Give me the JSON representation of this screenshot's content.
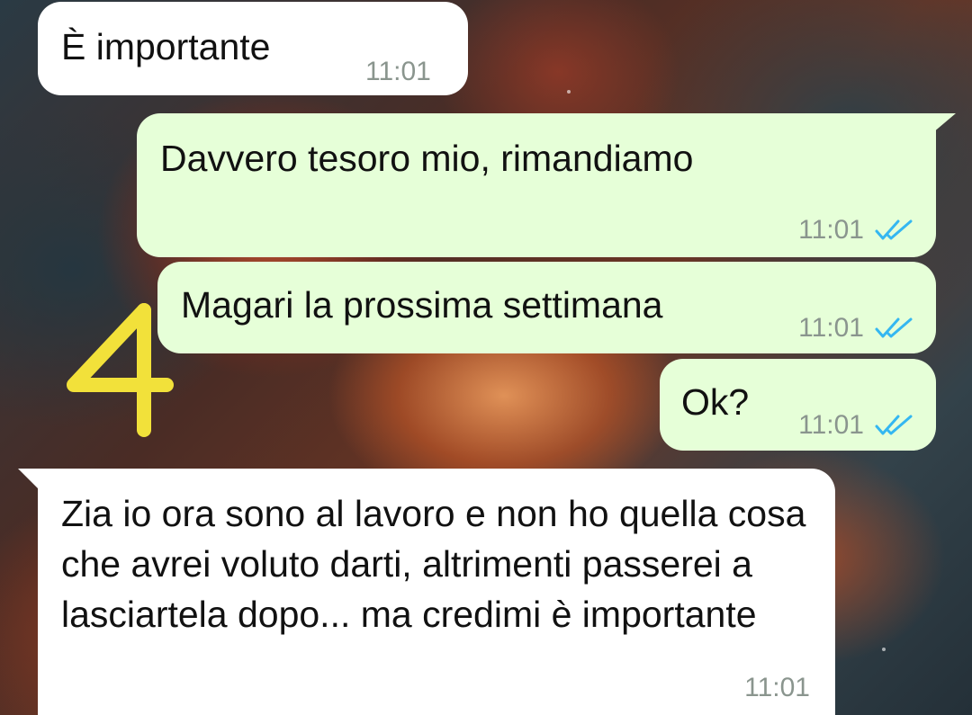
{
  "chat": {
    "messages": [
      {
        "direction": "incoming",
        "text": "È importante",
        "time": "11:01"
      },
      {
        "direction": "outgoing",
        "text": "Davvero tesoro mio, rimandiamo",
        "time": "11:01",
        "status": "read"
      },
      {
        "direction": "outgoing",
        "text": "Magari la prossima settimana",
        "time": "11:01",
        "status": "read"
      },
      {
        "direction": "outgoing",
        "text": "Ok?",
        "time": "11:01",
        "status": "read"
      },
      {
        "direction": "incoming",
        "text": "Zia io ora sono al lavoro e non ho quella cosa che avrei voluto darti, altrimenti passerei a lasciartela dopo... ma credimi è importante",
        "time": "11:01"
      }
    ]
  },
  "annotation": {
    "text": "4",
    "color": "#f2e13a"
  },
  "colors": {
    "incoming_bubble": "#ffffff",
    "outgoing_bubble": "#e6ffd8",
    "read_ticks": "#34b7f1",
    "timestamp": "#8a958e"
  },
  "icons": {
    "read_status": "double-check-icon"
  }
}
